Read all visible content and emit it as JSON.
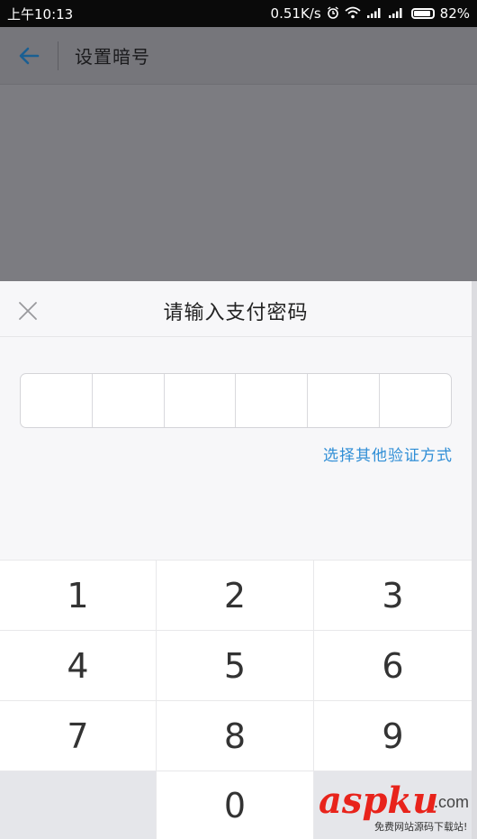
{
  "status_bar": {
    "time": "上午10:13",
    "net_speed": "0.51K/s",
    "battery": "82%"
  },
  "app_bar": {
    "title": "设置暗号"
  },
  "sheet": {
    "title": "请输入支付密码",
    "pin_length": 6,
    "alt_link": "选择其他验证方式"
  },
  "keypad": {
    "keys": [
      "1",
      "2",
      "3",
      "4",
      "5",
      "6",
      "7",
      "8",
      "9",
      "",
      "0",
      ""
    ]
  },
  "watermark": {
    "logo": "aspku",
    "domain": ".com",
    "caption": "免费网站源码下载站!"
  },
  "colors": {
    "accent": "#2f8ed6",
    "dim_overlay": "#76767b",
    "sheet_bg": "#f7f7f9"
  }
}
